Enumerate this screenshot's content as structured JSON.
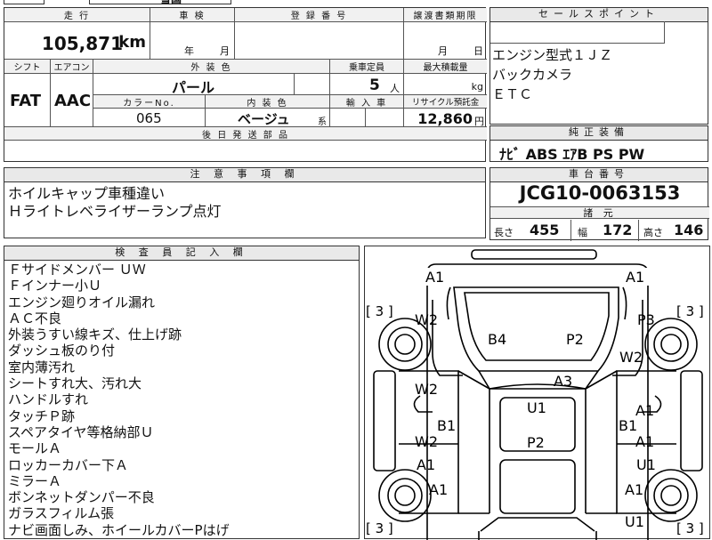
{
  "top_strip": {
    "fragment": "雪国"
  },
  "left_table": {
    "mileage_label": "走 行",
    "inspection_label": "車 検",
    "registration_label": "登 録 番 号",
    "transfer_label": "譲渡書類期限",
    "mileage": "105,871",
    "mileage_unit": "km",
    "year_unit": "年",
    "month_unit": "月",
    "transfer_month": "月",
    "transfer_day": "日",
    "shift_label": "シフト",
    "ac_label": "エアコン",
    "exterior_label": "外 装 色",
    "capacity_label": "乗車定員",
    "load_label": "最大積載量",
    "shift": "FAT",
    "ac": "AAC",
    "exterior": "パール",
    "capacity": "5",
    "capacity_unit": "人",
    "load_unit": "kg",
    "color_no_label": "カラーNo.",
    "interior_label": "内 装 色",
    "import_label": "輸 入 車",
    "recycle_label": "リサイクル預託金",
    "color_no": "065",
    "interior": "ベージュ",
    "interior_suffix": "系",
    "recycle": "12,860",
    "recycle_unit": "円",
    "later_parts_label": "後 日 発 送 部 品"
  },
  "sales_points": {
    "header": "セールスポイント",
    "lines": [
      "エンジン型式１ＪＺ",
      "バックカメラ",
      "ＥＴＣ"
    ]
  },
  "equipment": {
    "header": "純正装備",
    "text": "ﾅﾋﾞ ABS ｴｱB PS PW"
  },
  "caution": {
    "header": "注 意 事 項 欄",
    "lines": [
      "ホイルキャップ車種違い",
      "Ｈライトレベライザーランプ点灯"
    ]
  },
  "chassis": {
    "header": "車台番号",
    "number": "JCG10-0063153",
    "specs_header": "諸 元",
    "length_label": "長さ",
    "length": "455",
    "width_label": "幅",
    "width": "172",
    "height_label": "高さ",
    "height": "146"
  },
  "inspector": {
    "header": "検 査 員 記 入 欄",
    "notes": [
      "Ｆサイドメンバー ＵＷ",
      "Ｆインナー小Ｕ",
      "エンジン廻りオイル漏れ",
      "ＡＣ不良",
      "外装うすい線キズ、仕上げ跡",
      "ダッシュ板のり付",
      "室内薄汚れ",
      "シートすれ大、汚れ大",
      "ハンドルすれ",
      "タッチＰ跡",
      "スペアタイヤ等格納部Ｕ",
      "モールＡ",
      "ロッカーカバー下Ａ",
      "ミラーＡ",
      "ボンネットダンパー不良",
      "ガラスフィルム張",
      "ナビ画面しみ、ホイールカバーPはげ"
    ]
  },
  "diagram": {
    "marks": {
      "a1_tl": "A1",
      "a1_tr": "A1",
      "br_l1": "[ 3 ]",
      "br_r1": "[ 3 ]",
      "w2_lt": "W2",
      "p3_rt": "P3",
      "b4": "B4",
      "p2_hood": "P2",
      "w2_r": "W2",
      "a3": "A3",
      "w2_l2": "W2",
      "a1_r2": "A1",
      "u1_c": "U1",
      "b1_l": "B1",
      "b1_r": "B1",
      "w2_l3": "W2",
      "a1_r3": "A1",
      "p2_c": "P2",
      "a1_l4": "A1",
      "u1_r4": "U1",
      "a1_l5": "A1",
      "a1_r5": "A1",
      "br_l2": "[ 3 ]",
      "u1_r6": "U1",
      "br_r2": "[ 3 ]"
    }
  }
}
